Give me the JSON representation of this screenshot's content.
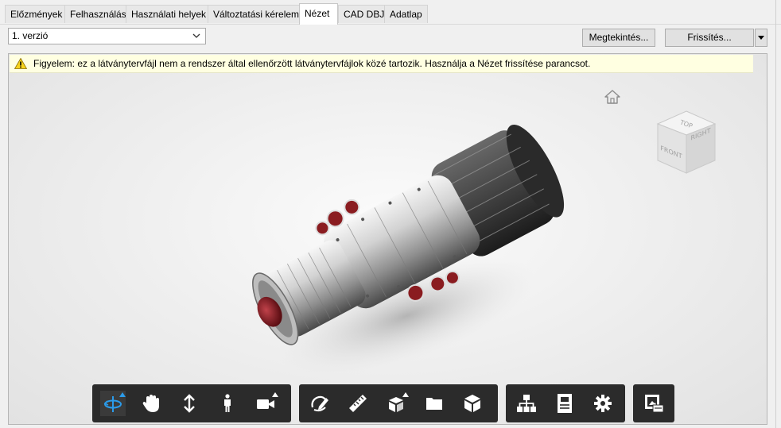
{
  "tabs": [
    {
      "label": "Előzmények",
      "active": false
    },
    {
      "label": "Felhasználás",
      "active": false
    },
    {
      "label": "Használati helyek",
      "active": false
    },
    {
      "label": "Változtatási kérelem",
      "active": false
    },
    {
      "label": "Nézet",
      "active": true
    },
    {
      "label": "CAD DBJ",
      "active": false
    },
    {
      "label": "Adatlap",
      "active": false
    }
  ],
  "version_select": {
    "value": "1. verzió"
  },
  "buttons": {
    "view": "Megtekintés...",
    "refresh": "Frissítés..."
  },
  "warning": {
    "text": "Figyelem: ez a látványtervfájl nem a rendszer által ellenőrzött látványtervfájlok közé tartozik. Használja a Nézet frissítése parancsot."
  },
  "viewcube": {
    "top": "TOP",
    "front": "FRONT",
    "right": "RIGHT"
  },
  "colors": {
    "accent": "#2b9bea",
    "toolbar_bg": "#2b2b2b",
    "warning_bg": "#ffffe1"
  },
  "toolbar": {
    "groups": [
      [
        "orbit-icon",
        "pan-icon",
        "zoom-icon",
        "walk-icon",
        "camera-icon"
      ],
      [
        "markup-icon",
        "measure-icon",
        "explode-icon",
        "model-browser-icon",
        "cube-icon"
      ],
      [
        "structure-icon",
        "properties-icon",
        "settings-icon"
      ],
      [
        "fullscreen-icon"
      ]
    ]
  }
}
